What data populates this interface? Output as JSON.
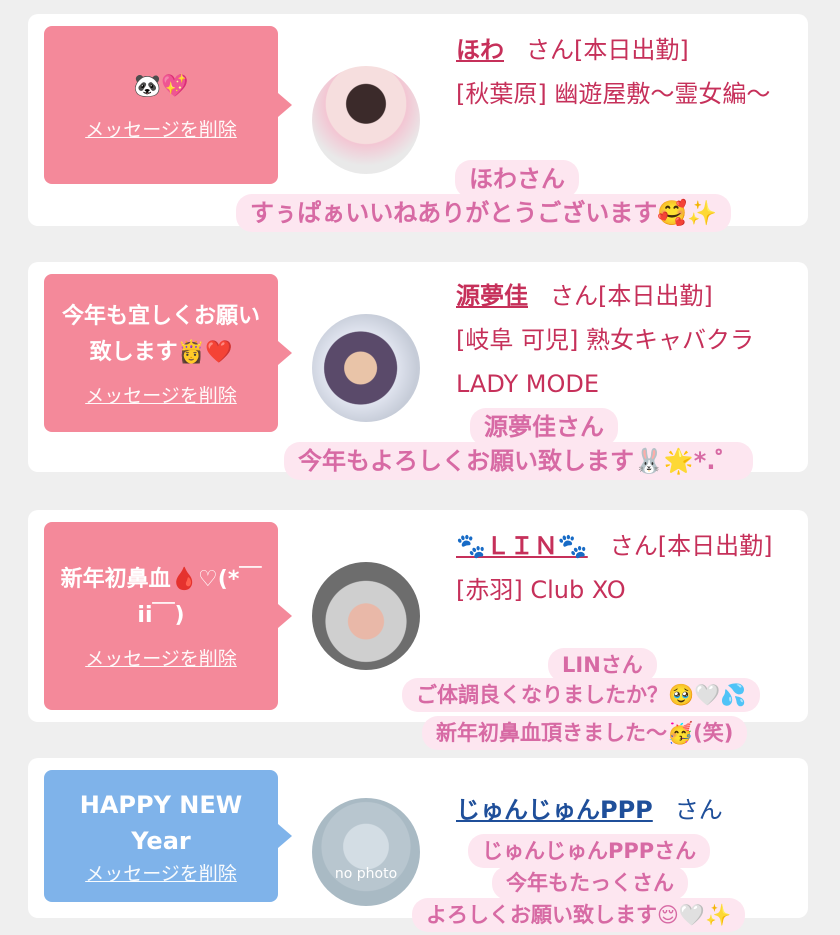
{
  "cards": [
    {
      "bubble_msg": "🐼💖",
      "delete_label": "メッセージを削除",
      "name": "ほわ",
      "san": "さん[本日出勤]",
      "shop": "[秋葉原] 幽遊屋敷〜霊女編〜",
      "overlay_name": "ほわさん",
      "overlay_text": "すぅぱぁいいねありがとうございます🥰✨"
    },
    {
      "bubble_msg": "今年も宜しくお願い致します👸❤️",
      "delete_label": "メッセージを削除",
      "name": "源夢佳",
      "san": "さん[本日出勤]",
      "shop": "[岐阜 可児] 熟女キャバクラ LADY MODE",
      "overlay_name": "源夢佳さん",
      "overlay_text": "今年もよろしくお願い致します🐰🌟*.゜"
    },
    {
      "bubble_msg": "新年初鼻血🩸♡(*￣ii￣)",
      "delete_label": "メッセージを削除",
      "name": "🐾ＬＩＮ🐾",
      "san": "さん[本日出勤]",
      "shop": "[赤羽] Club XO",
      "overlay_name": "LINさん",
      "overlay_text1": "ご体調良くなりましたか？🥹🤍💦",
      "overlay_text2": "新年初鼻血頂きました〜🥳(笑)"
    },
    {
      "bubble_msg": "HAPPY NEW Year",
      "delete_label": "メッセージを削除",
      "name": "じゅんじゅんPPP",
      "san": "さん",
      "avatar_text": "no photo",
      "overlay_name": "じゅんじゅんPPPさん",
      "overlay_text1": "今年もたっくさん",
      "overlay_text2": "よろしくお願い致します😌🤍✨"
    }
  ]
}
